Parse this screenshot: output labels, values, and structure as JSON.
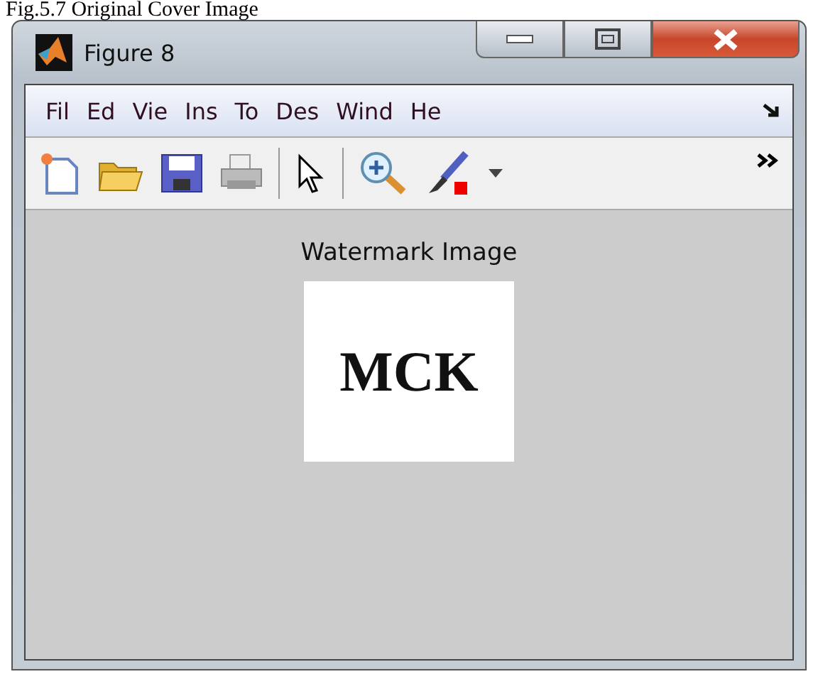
{
  "caption": "Fig.5.7 Original Cover Image",
  "window": {
    "title": "Figure 8"
  },
  "menu": [
    "Fil",
    "Ed",
    "Vie",
    "Ins",
    "To",
    "Des",
    "Wind",
    "He"
  ],
  "figure": {
    "title": "Watermark Image",
    "image_text": "MCK"
  }
}
